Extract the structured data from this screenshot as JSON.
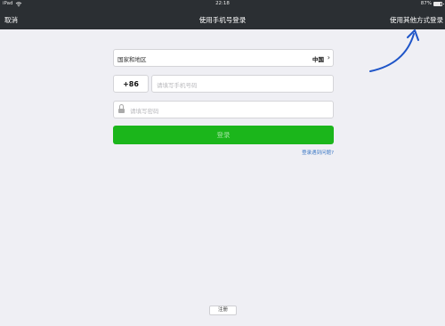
{
  "status_bar": {
    "carrier": "iPad",
    "time": "22:18",
    "battery": "87%"
  },
  "nav": {
    "cancel": "取消",
    "title": "使用手机号登录",
    "other_login": "使用其他方式登录"
  },
  "form": {
    "region_label": "国家和地区",
    "region_value": "中国",
    "country_code": "+86",
    "phone_placeholder": "请填写手机号码",
    "password_placeholder": "请填写密码",
    "login_button": "登录",
    "help_link": "登录遇到问题?"
  },
  "footer": {
    "register_button": "注册"
  },
  "colors": {
    "nav_bg": "#2b2f33",
    "primary_green": "#1bb61b",
    "link_blue": "#3a77c4",
    "annotation_arrow": "#1f55c8"
  },
  "icons": {
    "wifi": "wifi-icon",
    "battery": "battery-icon",
    "chevron": "chevron-right-icon",
    "lock": "lock-icon",
    "annotation": "curved-arrow-icon"
  }
}
